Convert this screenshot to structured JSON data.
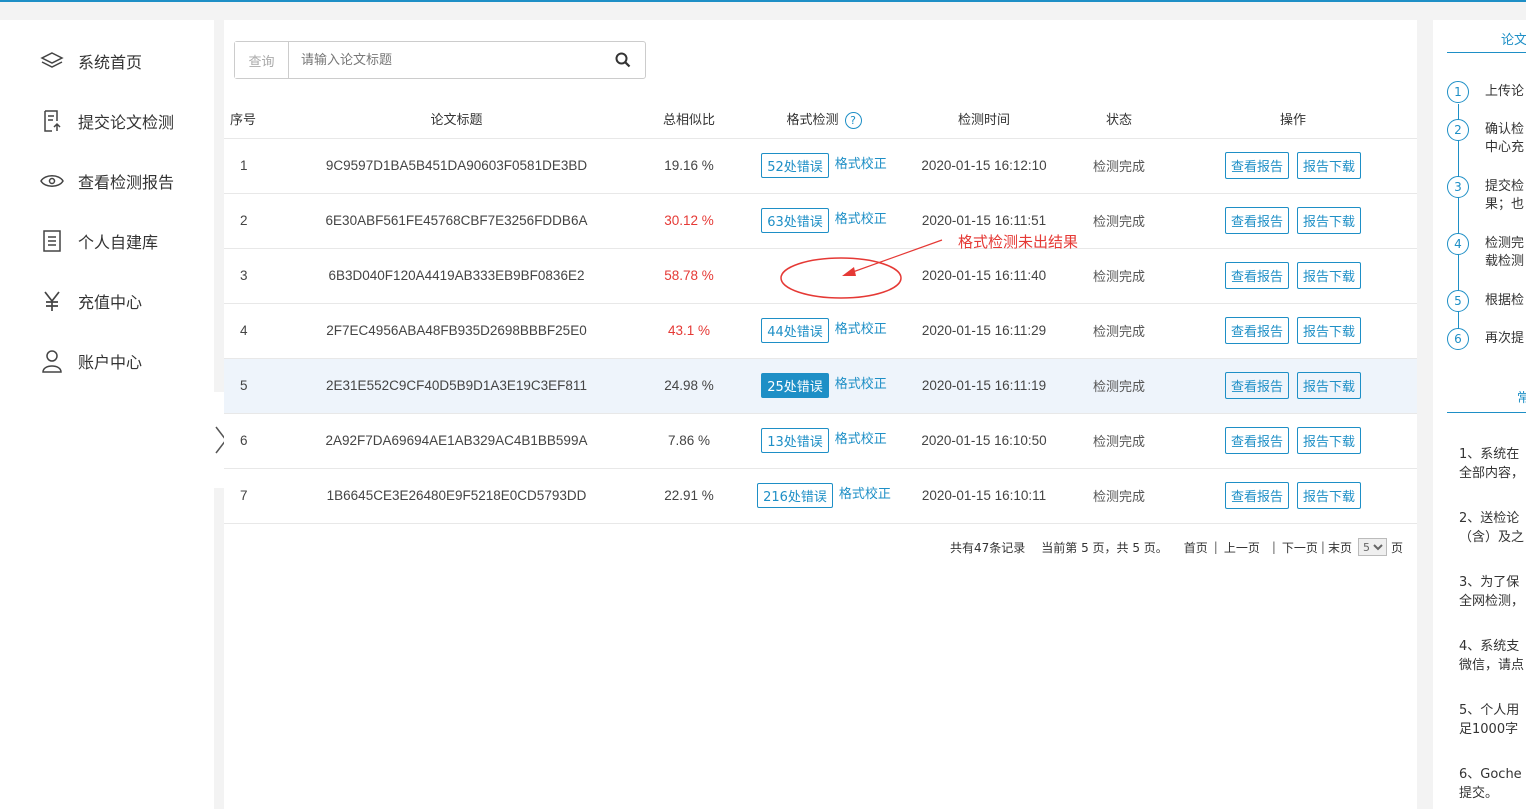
{
  "sidebar": {
    "items": [
      {
        "label": "系统首页",
        "icon": "layers-icon"
      },
      {
        "label": "提交论文检测",
        "icon": "upload-doc-icon"
      },
      {
        "label": "查看检测报告",
        "icon": "eye-icon"
      },
      {
        "label": "个人自建库",
        "icon": "library-icon"
      },
      {
        "label": "充值中心",
        "icon": "yen-icon"
      },
      {
        "label": "账户中心",
        "icon": "user-icon"
      }
    ]
  },
  "search": {
    "prefix": "查询",
    "placeholder": "请输入论文标题"
  },
  "table": {
    "headers": {
      "index": "序号",
      "title": "论文标题",
      "similarity": "总相似比",
      "format": "格式检测",
      "time": "检测时间",
      "status": "状态",
      "ops": "操作"
    },
    "fix_label": "格式校正",
    "view_label": "查看报告",
    "download_label": "报告下载",
    "rows": [
      {
        "index": "1",
        "title": "9C9597D1BA5B451DA90603F0581DE3BD",
        "similarity": "19.16 %",
        "errors": "52处错误",
        "time": "2020-01-15 16:12:10",
        "status": "检测完成"
      },
      {
        "index": "2",
        "title": "6E30ABF561FE45768CBF7E3256FDDB6A",
        "similarity": "30.12 %",
        "errors": "63处错误",
        "time": "2020-01-15 16:11:51",
        "status": "检测完成"
      },
      {
        "index": "3",
        "title": "6B3D040F120A4419AB333EB9BF0836E2",
        "similarity": "58.78 %",
        "errors": "",
        "time": "2020-01-15 16:11:40",
        "status": "检测完成"
      },
      {
        "index": "4",
        "title": "2F7EC4956ABA48FB935D2698BBBF25E0",
        "similarity": "43.1 %",
        "errors": "44处错误",
        "time": "2020-01-15 16:11:29",
        "status": "检测完成"
      },
      {
        "index": "5",
        "title": "2E31E552C9CF40D5B9D1A3E19C3EF811",
        "similarity": "24.98 %",
        "errors": "25处错误",
        "time": "2020-01-15 16:11:19",
        "status": "检测完成"
      },
      {
        "index": "6",
        "title": "2A92F7DA69694AE1AB329AC4B1BB599A",
        "similarity": "7.86 %",
        "errors": "13处错误",
        "time": "2020-01-15 16:10:50",
        "status": "检测完成"
      },
      {
        "index": "7",
        "title": "1B6645CE3E26480E9F5218E0CD5793DD",
        "similarity": "22.91 %",
        "errors": "216处错误",
        "time": "2020-01-15 16:10:11",
        "status": "检测完成"
      }
    ]
  },
  "pager": {
    "total": "共有47条记录",
    "current": "当前第 5 页，共 5 页。",
    "first": "首页",
    "prev": "上一页",
    "next": "下一页",
    "last": "末页",
    "selected_page": "5",
    "suffix": "页"
  },
  "annotation": {
    "text": "格式检测未出结果",
    "color": "#e53935"
  },
  "right_panel": {
    "title": "论文",
    "steps": [
      {
        "num": "1",
        "line1": "上传论",
        "line2": ""
      },
      {
        "num": "2",
        "line1": "确认检",
        "line2": "中心充"
      },
      {
        "num": "3",
        "line1": "提交检",
        "line2": "果；也"
      },
      {
        "num": "4",
        "line1": "检测完",
        "line2": "载检测"
      },
      {
        "num": "5",
        "line1": "根据检",
        "line2": ""
      },
      {
        "num": "6",
        "line1": "再次提",
        "line2": ""
      }
    ],
    "title2": "常",
    "notes": [
      {
        "line1": "1、系统在",
        "line2": "全部内容，"
      },
      {
        "line1": "2、送检论",
        "line2": "（含）及之"
      },
      {
        "line1": "3、为了保",
        "line2": "全网检测，"
      },
      {
        "line1": "4、系统支",
        "line2": "微信，请点"
      },
      {
        "line1": "5、个人用",
        "line2": "足1000字"
      },
      {
        "line1": "6、Goche",
        "line2": "提交。"
      }
    ]
  },
  "colors": {
    "accent": "#1e8fc6",
    "danger": "#e53935",
    "highlight_row": "#eef4fb"
  }
}
